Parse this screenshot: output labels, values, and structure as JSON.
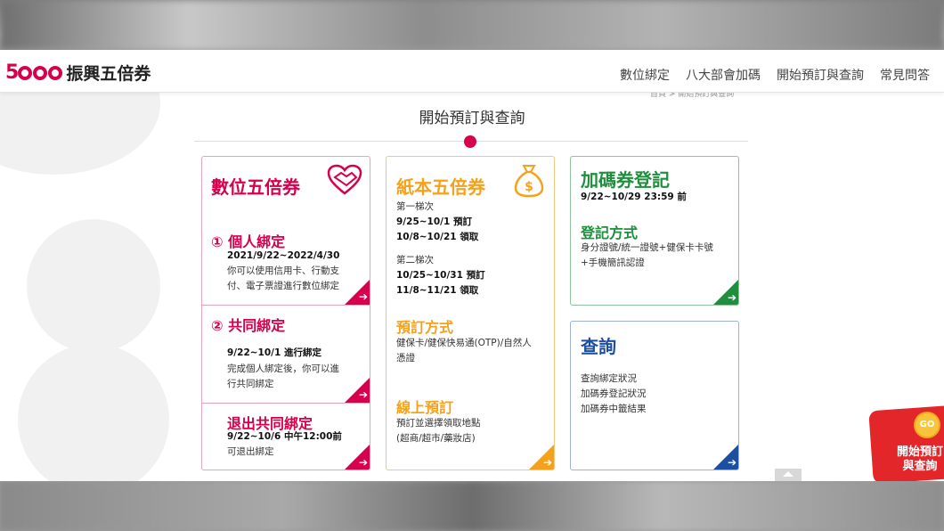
{
  "header": {
    "logo_number": "5000",
    "logo_text": "振興五倍券",
    "nav": [
      "數位綁定",
      "八大部會加碼",
      "開始預訂與查詢",
      "常見問答"
    ]
  },
  "breadcrumb": "首頁 > 開始預訂與查詢",
  "section_title": "開始預訂與查詢",
  "digital": {
    "title": "數位五倍券",
    "personal": {
      "title": "① 個人綁定",
      "date": "2021/9/22~2022/4/30",
      "desc1": "你可以使用信用卡、行動支",
      "desc2": "付、電子票證進行數位綁定"
    },
    "joint": {
      "title": "② 共同綁定",
      "date": "9/22~10/1 進行綁定",
      "desc1": "完成個人綁定後，你可以進",
      "desc2": "行共同綁定"
    },
    "exit": {
      "title": "退出共同綁定",
      "date": "9/22~10/6 中午12:00前",
      "desc": "可退出綁定"
    }
  },
  "paper": {
    "title": "紙本五倍券",
    "wave1_label": "第一梯次",
    "wave1_line1": "9/25~10/1 預訂",
    "wave1_line2": "10/8~10/21 領取",
    "wave2_label": "第二梯次",
    "wave2_line1": "10/25~10/31 預訂",
    "wave2_line2": "11/8~11/21 領取",
    "method_title": "預訂方式",
    "method_desc1": "健保卡/健保快易通(OTP)/自然人",
    "method_desc2": "憑證",
    "online_title": "線上預訂",
    "online_desc1": "預訂並選擇領取地點",
    "online_desc2": "(超商/超市/藥妝店)"
  },
  "bonus": {
    "title": "加碼券登記",
    "date": "9/22~10/29 23:59 前",
    "method_title": "登記方式",
    "method_desc1": "身分證號/統一證號+健保卡卡號",
    "method_desc2": "+手機簡訊認證"
  },
  "query": {
    "title": "查詢",
    "items": [
      "查詢綁定狀況",
      "加碼券登記狀況",
      "加碼券中籤結果"
    ]
  },
  "promo": {
    "coin": "GO",
    "line1": "開始預訂",
    "line2": "與查詢"
  },
  "colors": {
    "pink": "#d6004c",
    "orange": "#f4a21b",
    "green": "#1f8f3d",
    "blue": "#1d4fa0"
  }
}
